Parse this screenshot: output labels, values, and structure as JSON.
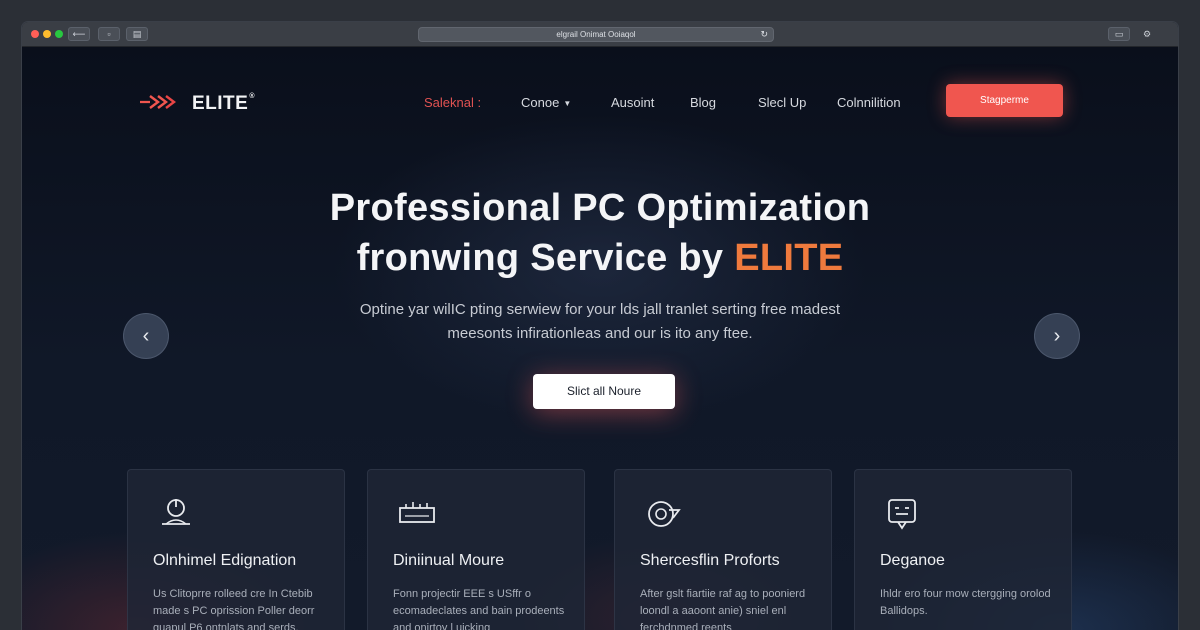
{
  "browser": {
    "url": "elgrail Onimat Ooiaqol"
  },
  "brand": {
    "name": "ELITE",
    "mark": "®",
    "accent_color": "#f0564f",
    "highlight_color": "#ef7a3d"
  },
  "nav": {
    "items": [
      {
        "label": "Saleknal :",
        "active": true
      },
      {
        "label": "Conoe",
        "dropdown": true
      },
      {
        "label": "Ausoint"
      },
      {
        "label": "Blog"
      },
      {
        "label": "Slecl Up"
      },
      {
        "label": "Colnnilition"
      }
    ],
    "cta_label": "Stagperme"
  },
  "hero": {
    "title_line1": "Professional PC Optimization",
    "title_line2_prefix": "fronwing Service by ",
    "title_line2_accent": "ELITE",
    "subtitle_line1": "Optine yar wilIC pting serwiew for your lds jall tranlet serting free madest",
    "subtitle_line2": "meesonts infirationleas and our is ito any ftee.",
    "button_label": "Slict all Noure"
  },
  "carousel": {
    "prev_icon": "chevron-left-icon",
    "next_icon": "chevron-right-icon"
  },
  "features": [
    {
      "icon": "power-icon",
      "title": "Olnhimel Edignation",
      "desc": "Us Clitoprre rolleed cre In Ctebib made s PC oprission Poller deorr guapul P6 ontnlats and serds. Logsse ehiutd Bek Moquan."
    },
    {
      "icon": "hardware-icon",
      "title": "Diniinual Moure",
      "desc": "Fonn projectir EEE s USffr o ecomadeclates and bain prodeents and onirtoy l uicking"
    },
    {
      "icon": "speed-icon",
      "title": "Shercesflin Proforts",
      "desc": "After gslt fiartiie raf ag to poonierd loondl a aaoont anie) sniel enl ferchdnmed reents"
    },
    {
      "icon": "chat-icon",
      "title": "Deganoe",
      "desc": "Ihldr ero four mow ctergging orolod Ballidops."
    }
  ]
}
